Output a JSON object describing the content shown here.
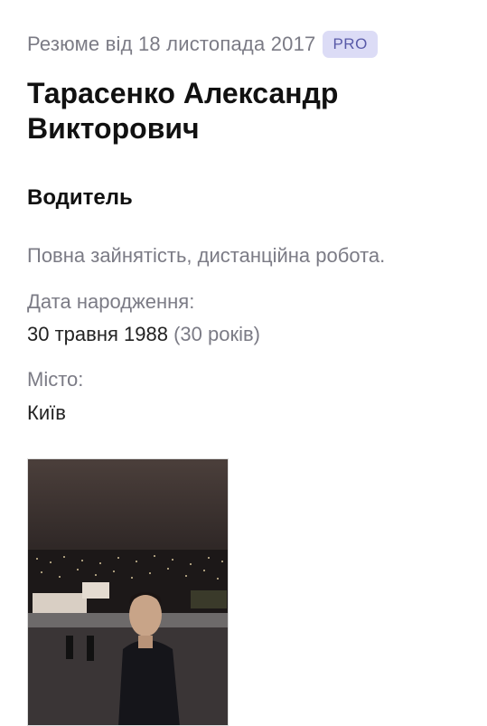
{
  "header": {
    "resume_date": "Резюме від 18 листопада 2017",
    "badge": "PRO"
  },
  "profile": {
    "name": "Тарасенко Александр Викторович",
    "position": "Водитель",
    "employment": "Повна зайнятість, дистанційна робота.",
    "birth_label": "Дата народження:",
    "birth_date": "30 травня 1988",
    "age": "(30 років)",
    "city_label": "Місто:",
    "city": "Київ"
  }
}
